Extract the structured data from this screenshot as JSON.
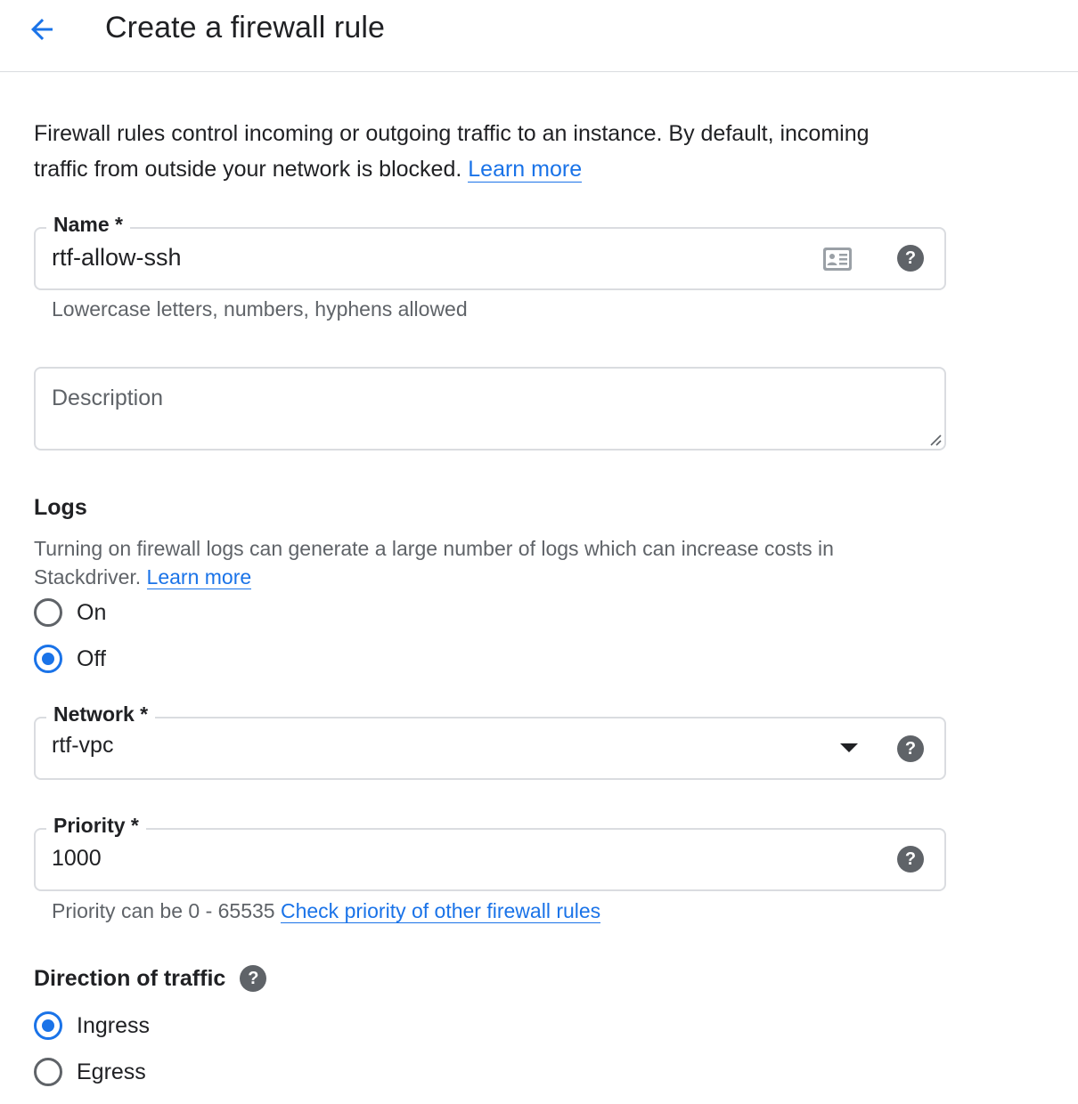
{
  "header": {
    "title": "Create a firewall rule"
  },
  "intro": {
    "text": "Firewall rules control incoming or outgoing traffic to an instance. By default, incoming traffic from outside your network is blocked.",
    "link": "Learn more"
  },
  "name_field": {
    "label": "Name *",
    "value": "rtf-allow-ssh",
    "hint": "Lowercase letters, numbers, hyphens allowed"
  },
  "description_field": {
    "placeholder": "Description"
  },
  "logs": {
    "title": "Logs",
    "text": "Turning on firewall logs can generate a large number of logs which can increase costs in Stackdriver.",
    "link": "Learn more",
    "options": [
      {
        "label": "On",
        "selected": false
      },
      {
        "label": "Off",
        "selected": true
      }
    ]
  },
  "network_field": {
    "label": "Network *",
    "value": "rtf-vpc"
  },
  "priority_field": {
    "label": "Priority *",
    "value": "1000",
    "hint": "Priority can be 0 - 65535",
    "hint_link": "Check priority of other firewall rules"
  },
  "direction": {
    "title": "Direction of traffic",
    "options": [
      {
        "label": "Ingress",
        "selected": true
      },
      {
        "label": "Egress",
        "selected": false
      }
    ]
  },
  "colors": {
    "accent": "#1a73e8",
    "border": "#dadce0",
    "icon": "#5f6368"
  }
}
